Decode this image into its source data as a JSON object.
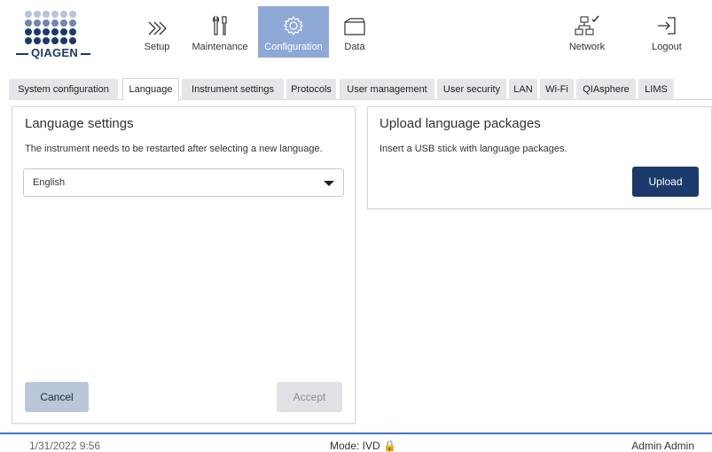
{
  "app": {
    "logo_text": "QIAGEN"
  },
  "nav": {
    "setup": "Setup",
    "maintenance": "Maintenance",
    "configuration": "Configuration",
    "data": "Data",
    "network": "Network",
    "logout": "Logout"
  },
  "tabs": [
    {
      "label": "System configuration"
    },
    {
      "label": "Language",
      "active": true
    },
    {
      "label": "Instrument settings"
    },
    {
      "label": "Protocols"
    },
    {
      "label": "User management"
    },
    {
      "label": "User security"
    },
    {
      "label": "LAN"
    },
    {
      "label": "Wi-Fi"
    },
    {
      "label": "QIAsphere"
    },
    {
      "label": "LIMS"
    }
  ],
  "language_panel": {
    "title": "Language settings",
    "description": "The instrument needs to be restarted after selecting a new language.",
    "selected_language": "English",
    "cancel_label": "Cancel",
    "accept_label": "Accept"
  },
  "upload_panel": {
    "title": "Upload language packages",
    "description": "Insert a USB stick with language packages.",
    "upload_label": "Upload"
  },
  "status": {
    "datetime": "1/31/2022 9:56",
    "mode": "Mode: IVD 🔒",
    "user": "Admin Admin"
  },
  "colors": {
    "brand": "#1b3a6b",
    "nav_active": "#8fa9d7",
    "status_line": "#4472c4"
  },
  "icons": [
    "chevrons-right-icon",
    "tools-icon",
    "gear-icon",
    "folder-icon",
    "network-icon",
    "logout-icon",
    "lock-icon"
  ]
}
